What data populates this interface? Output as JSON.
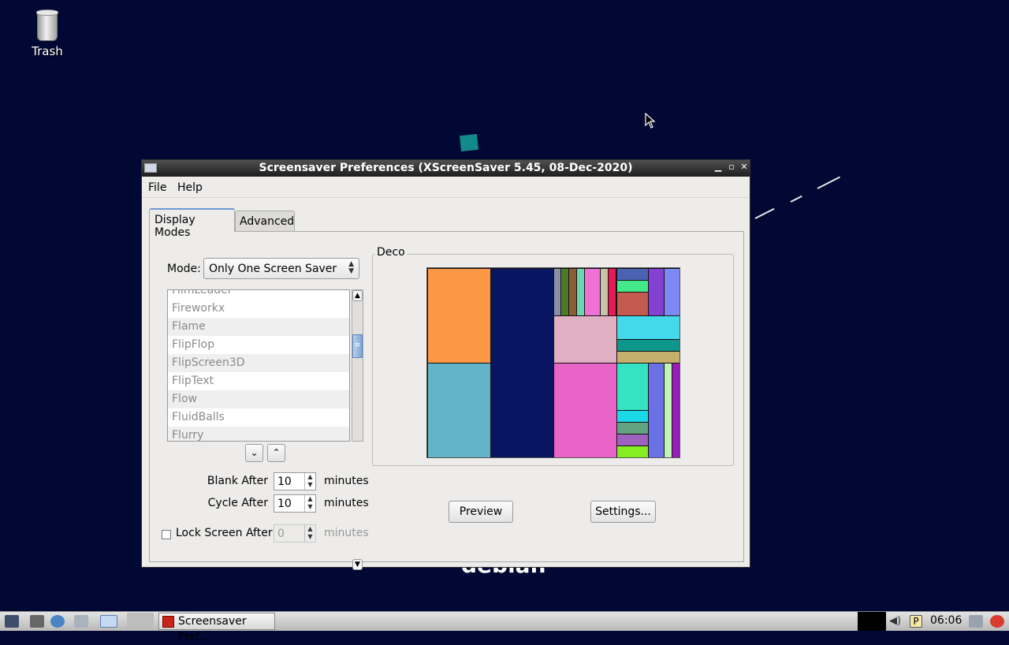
{
  "desktop": {
    "trash_label": "Trash",
    "wallpaper_text": "debian"
  },
  "window": {
    "title": "Screensaver Preferences  (XScreenSaver 5.45, 08-Dec-2020)",
    "controls": {
      "minimize": "▁",
      "maximize": "▫",
      "close": "✕"
    }
  },
  "menu": {
    "file": "File",
    "help": "Help"
  },
  "tabs": {
    "display_modes": "Display Modes",
    "advanced": "Advanced"
  },
  "mode": {
    "label": "Mode:",
    "selected": "Only One Screen Saver"
  },
  "screensaver_list": [
    "FilmLeader",
    "Fireworkx",
    "Flame",
    "FlipFlop",
    "FlipScreen3D",
    "FlipText",
    "Flow",
    "FluidBalls",
    "Flurry"
  ],
  "list_buttons": {
    "down": "⌄",
    "up": "⌃"
  },
  "settings": {
    "blank_after_label": "Blank After",
    "blank_after_value": "10",
    "cycle_after_label": "Cycle After",
    "cycle_after_value": "10",
    "lock_label": "Lock Screen After",
    "lock_value": "0",
    "lock_checked": false,
    "minutes": "minutes"
  },
  "preview": {
    "frame_label": "Deco",
    "preview_button": "Preview",
    "settings_button": "Settings..."
  },
  "taskbar": {
    "task_label": "Screensaver Pref...",
    "clock": "06:06"
  }
}
